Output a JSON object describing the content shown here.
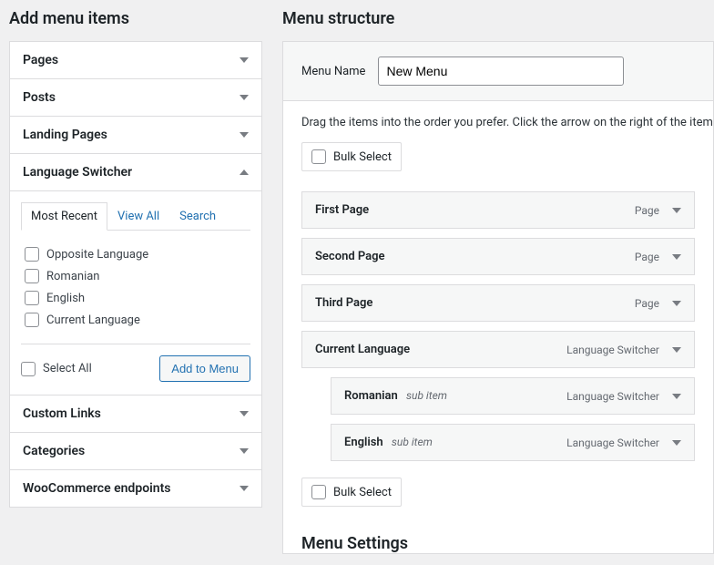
{
  "left": {
    "heading": "Add menu items",
    "sections": {
      "pages": "Pages",
      "posts": "Posts",
      "landing": "Landing Pages",
      "lang": "Language Switcher",
      "custom": "Custom Links",
      "categories": "Categories",
      "woo": "WooCommerce endpoints"
    },
    "tabs": {
      "recent": "Most Recent",
      "viewall": "View All",
      "search": "Search"
    },
    "lang_items": {
      "opposite": "Opposite Language",
      "romanian": "Romanian",
      "english": "English",
      "current": "Current Language"
    },
    "select_all": "Select All",
    "add_btn": "Add to Menu"
  },
  "right": {
    "heading": "Menu structure",
    "name_label": "Menu Name",
    "name_value": "New Menu",
    "instructions": "Drag the items into the order you prefer. Click the arrow on the right of the item",
    "bulk": "Bulk Select",
    "type_page": "Page",
    "type_lang": "Language Switcher",
    "sub_item": "sub item",
    "items": {
      "first": "First Page",
      "second": "Second Page",
      "third": "Third Page",
      "curlang": "Current Language",
      "ro": "Romanian",
      "en": "English"
    },
    "settings_heading": "Menu Settings"
  }
}
